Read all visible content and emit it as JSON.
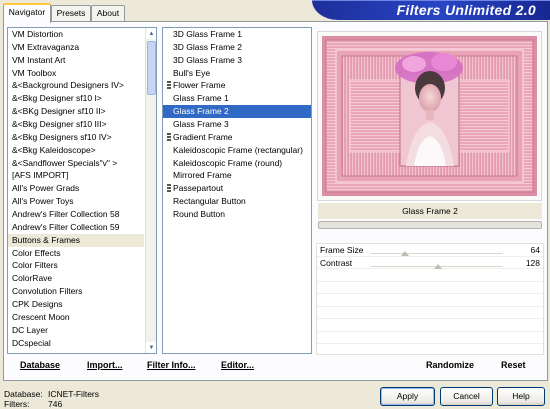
{
  "tabs": [
    {
      "label": "Navigator",
      "active": true
    },
    {
      "label": "Presets",
      "active": false
    },
    {
      "label": "About",
      "active": false
    }
  ],
  "app_title": "Filters Unlimited 2.0",
  "categories": [
    "VM Distortion",
    "VM Extravaganza",
    "VM Instant Art",
    "VM Toolbox",
    "&<Background Designers IV>",
    "&<Bkg Designer sf10 I>",
    "&<BKg Designer sf10 II>",
    "&<Bkg Designer sf10 III>",
    "&<Bkg Designers sf10 IV>",
    "&<Bkg Kaleidoscope>",
    "&<Sandflower Specials\"v\" >",
    "[AFS IMPORT]",
    "All's Power Grads",
    "All's Power Toys",
    "Andrew's Filter Collection 58",
    "Andrew's Filter Collection 59",
    "Buttons & Frames",
    "Color Effects",
    "Color Filters",
    "ColorRave",
    "Convolution Filters",
    "CPK Designs",
    "Crescent Moon",
    "DC Layer",
    "DCspecial"
  ],
  "selected_category": "Buttons & Frames",
  "filters": [
    {
      "label": "3D Glass Frame 1",
      "group": false
    },
    {
      "label": "3D Glass Frame 2",
      "group": false
    },
    {
      "label": "3D Glass Frame 3",
      "group": false
    },
    {
      "label": "Bull's Eye",
      "group": false
    },
    {
      "label": "Flower Frame",
      "group": true
    },
    {
      "label": "Glass Frame 1",
      "group": false
    },
    {
      "label": "Glass Frame 2",
      "group": false
    },
    {
      "label": "Glass Frame 3",
      "group": false
    },
    {
      "label": "Gradient Frame",
      "group": true
    },
    {
      "label": "Kaleidoscopic Frame (rectangular)",
      "group": false
    },
    {
      "label": "Kaleidoscopic Frame (round)",
      "group": false
    },
    {
      "label": "Mirrored Frame",
      "group": false
    },
    {
      "label": "Passepartout",
      "group": true
    },
    {
      "label": "Rectangular Button",
      "group": false
    },
    {
      "label": "Round Button",
      "group": false
    }
  ],
  "selected_filter": "Glass Frame 2",
  "current_filter_name": "Glass Frame 2",
  "controls": [
    {
      "label": "Frame Size",
      "value": "64",
      "level": 0.25
    },
    {
      "label": "Contrast",
      "value": "128",
      "level": 0.5
    }
  ],
  "bottom_links": {
    "database": "Database",
    "import": "Import...",
    "filter_info": "Filter Info...",
    "editor": "Editor...",
    "randomize": "Randomize",
    "reset": "Reset"
  },
  "footer": {
    "database_label": "Database:",
    "database_value": "ICNET-Filters",
    "filters_label": "Filters:",
    "filters_value": "746"
  },
  "buttons": {
    "apply": "Apply",
    "cancel": "Cancel",
    "help": "Help"
  },
  "colors": {
    "selection": "#316ac5",
    "logo_bg": "#2845c4",
    "preview_pink": "#e79ab1"
  }
}
